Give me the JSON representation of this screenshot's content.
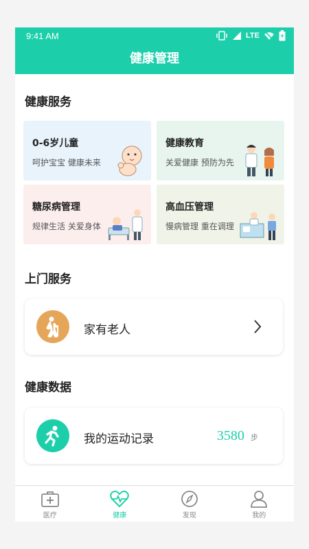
{
  "status_bar": {
    "time": "9:41 AM",
    "network": "LTE"
  },
  "app_bar": {
    "title": "健康管理"
  },
  "health_services": {
    "title": "健康服务",
    "cards": [
      {
        "title": "0-6岁儿童",
        "subtitle": "呵护宝宝 健康未来",
        "bg": "#e8f3fc",
        "icon": "baby-illustration"
      },
      {
        "title": "健康教育",
        "subtitle": "关爱健康 预防为先",
        "bg": "#e8f5ef",
        "icon": "doctor-family-illustration"
      },
      {
        "title": "糖尿病管理",
        "subtitle": "规律生活 关爱身体",
        "bg": "#fdeeee",
        "icon": "patient-doctor-illustration"
      },
      {
        "title": "高血压管理",
        "subtitle": "慢病管理 重在调理",
        "bg": "#f0f3e8",
        "icon": "clinic-illustration"
      }
    ]
  },
  "home_services": {
    "title": "上门服务",
    "item": {
      "label": "家有老人",
      "icon": "elderly-person-icon",
      "color": "#e6a65a"
    }
  },
  "health_data": {
    "title": "健康数据",
    "item": {
      "label": "我的运动记录",
      "value": "3580",
      "unit": "步",
      "icon": "running-icon",
      "color": "#1ccfaa"
    }
  },
  "tabs": [
    {
      "label": "医疗",
      "icon": "medical-kit-icon",
      "active": false
    },
    {
      "label": "健康",
      "icon": "heartbeat-icon",
      "active": true
    },
    {
      "label": "发现",
      "icon": "compass-icon",
      "active": false
    },
    {
      "label": "我的",
      "icon": "user-icon",
      "active": false
    }
  ],
  "colors": {
    "accent": "#1ccfaa",
    "elderly": "#e6a65a"
  }
}
